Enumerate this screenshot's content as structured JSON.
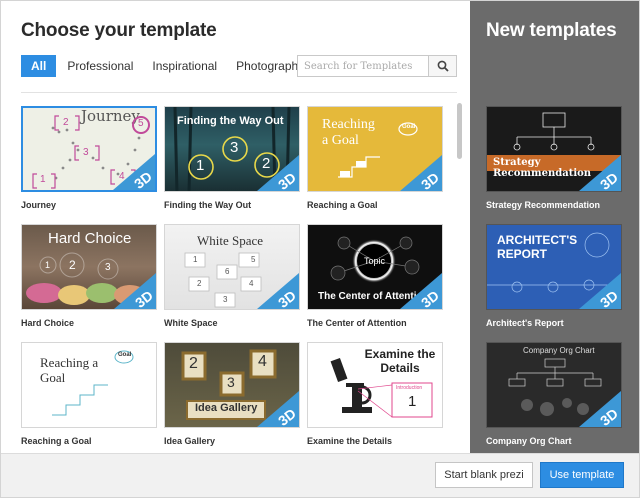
{
  "dialog": {
    "title": "Choose your template",
    "new_templates_title": "New templates"
  },
  "filters": [
    {
      "label": "All",
      "active": true
    },
    {
      "label": "Professional",
      "active": false
    },
    {
      "label": "Inspirational",
      "active": false
    },
    {
      "label": "Photographic",
      "active": false
    }
  ],
  "search": {
    "placeholder": "Search for Templates",
    "icon": "search-icon"
  },
  "templates": [
    {
      "label": "Journey",
      "thumb_title": "Journey",
      "numbers": [
        "1",
        "2",
        "3",
        "4",
        "5"
      ],
      "badge": "3D",
      "selected": true
    },
    {
      "label": "Finding the Way Out",
      "thumb_title": "Finding the Way Out",
      "numbers": [
        "1",
        "3",
        "2"
      ],
      "badge": "3D"
    },
    {
      "label": "Reaching a Goal",
      "thumb_title": "Reaching a Goal",
      "goal_word": "Goal",
      "badge": "3D"
    },
    {
      "label": "Hard Choice",
      "thumb_title": "Hard Choice",
      "numbers": [
        "1",
        "2",
        "3"
      ],
      "badge": "3D"
    },
    {
      "label": "White Space",
      "thumb_title": "White Space",
      "numbers": [
        "1",
        "5",
        "6",
        "2",
        "4",
        "3"
      ],
      "badge": "3D"
    },
    {
      "label": "The Center of Attention",
      "thumb_title": "The Center of Attention",
      "center_word": "Topic",
      "badge": "3D"
    },
    {
      "label": "Reaching a Goal",
      "thumb_title": "Reaching a Goal",
      "goal_word": "Goal"
    },
    {
      "label": "Idea Gallery",
      "thumb_title": "Idea Gallery",
      "numbers": [
        "2",
        "4",
        "3"
      ],
      "badge": "3D"
    },
    {
      "label": "Examine the Details",
      "thumb_title": "Examine the Details",
      "intro_word": "Introduction",
      "number": "1"
    }
  ],
  "new_templates": [
    {
      "label": "Strategy Recommendation",
      "thumb_title": "Strategy Recommendation",
      "badge": "3D"
    },
    {
      "label": "Architect's Report",
      "thumb_title": "ARCHITECT'S REPORT",
      "badge": "3D"
    },
    {
      "label": "Company Org Chart",
      "thumb_title": "Company Org Chart",
      "badge": "3D"
    }
  ],
  "footer": {
    "blank_button": "Start blank prezi",
    "use_button": "Use template"
  },
  "colors": {
    "accent": "#2d8de2",
    "sidebar": "#6b6b6b",
    "badge": "#3d98d6"
  }
}
